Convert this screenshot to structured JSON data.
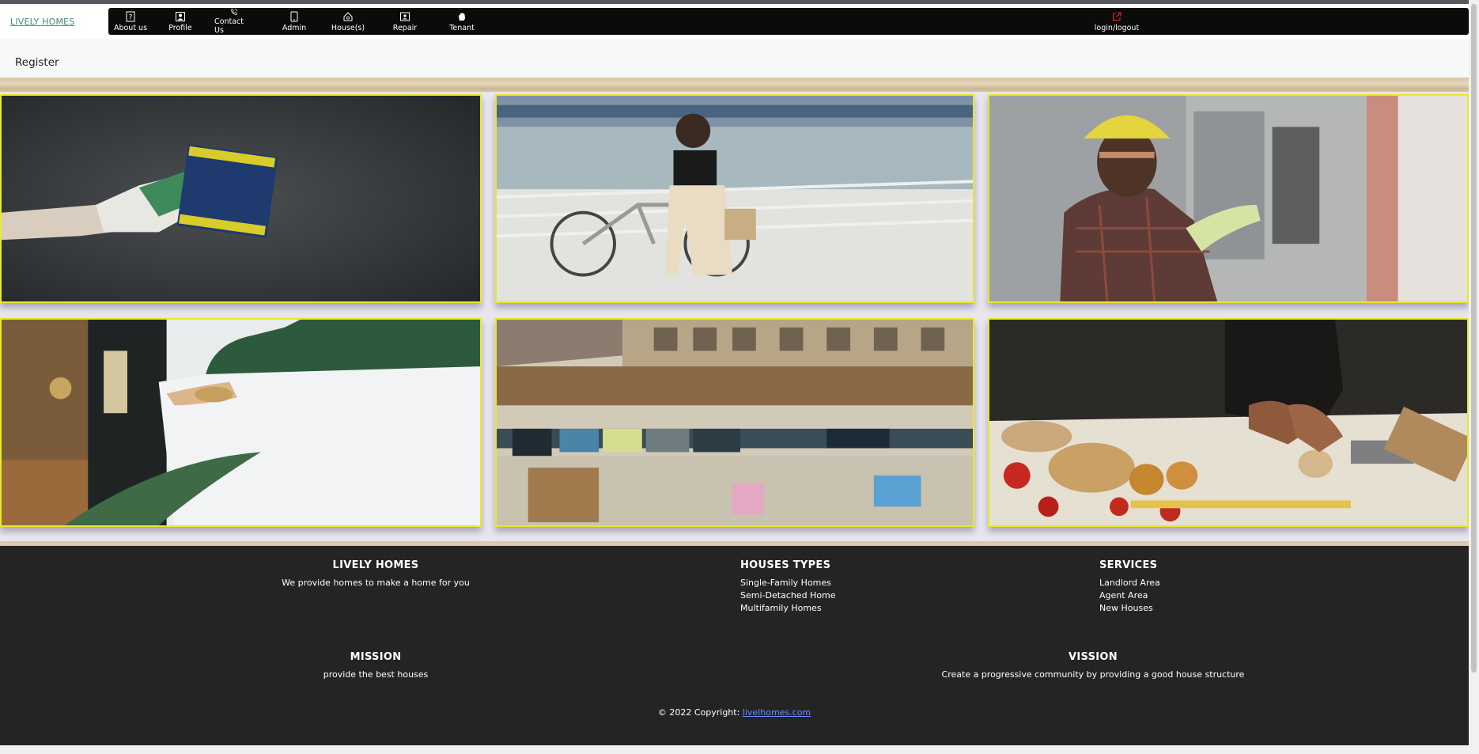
{
  "brand": "LIVELY HOMES",
  "nav": {
    "items": [
      {
        "label": "About us",
        "icon": "question-icon"
      },
      {
        "label": "Profile",
        "icon": "profile-icon"
      },
      {
        "label": "Contact Us",
        "icon": "phone-icon"
      },
      {
        "label": "Admin",
        "icon": "tablet-icon"
      },
      {
        "label": "House(s)",
        "icon": "house-icon"
      },
      {
        "label": "Repair",
        "icon": "person-badge-icon"
      },
      {
        "label": "Tenant",
        "icon": "hand-icon"
      }
    ],
    "login": {
      "label": "login/logout",
      "icon": "external-link-icon"
    }
  },
  "subbar": {
    "register_label": "Register"
  },
  "gallery": {
    "tiles": [
      {
        "name": "plastering-wall-photo"
      },
      {
        "name": "woman-bicycle-photo"
      },
      {
        "name": "electrician-photo"
      },
      {
        "name": "door-handle-photo"
      },
      {
        "name": "apartment-laundry-photo"
      },
      {
        "name": "baking-kitchen-photo"
      }
    ],
    "border_color": "#e6ea2a"
  },
  "footer": {
    "lively": {
      "title": "LIVELY HOMES",
      "text": "We provide homes to make a home for you"
    },
    "houses": {
      "title": "HOUSES TYPES",
      "items": [
        "Single-Family Homes",
        "Semi-Detached Home",
        "Multifamily Homes"
      ]
    },
    "services": {
      "title": "SERVICES",
      "items": [
        "Landlord Area",
        "Agent Area",
        "New Houses"
      ]
    },
    "mission": {
      "title": "MISSION",
      "text": "provide the best houses"
    },
    "vission": {
      "title": "VISSION",
      "text": "Create a progressive community by providing a good house structure"
    },
    "copyright_prefix": "© 2022 Copyright:",
    "copyright_link": "livelhomes.com"
  },
  "colors": {
    "nav_bg": "#0b0b0b",
    "footer_bg": "#242424",
    "brand": "#3d8b73",
    "link": "#6a8cff"
  }
}
